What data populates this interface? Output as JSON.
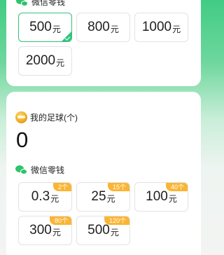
{
  "top_section": {
    "title": "微信零钱",
    "options": [
      {
        "amount": "500",
        "unit": "元",
        "selected": true
      },
      {
        "amount": "800",
        "unit": "元"
      },
      {
        "amount": "1000",
        "unit": "元"
      },
      {
        "amount": "2000",
        "unit": "元"
      }
    ]
  },
  "balls": {
    "label": "我的足球(个)",
    "count": "0"
  },
  "bottom_section": {
    "title": "微信零钱",
    "options": [
      {
        "amount": "0.3",
        "unit": "元",
        "badge": "2个"
      },
      {
        "amount": "25",
        "unit": "元",
        "badge": "15个"
      },
      {
        "amount": "100",
        "unit": "元",
        "badge": "40个"
      },
      {
        "amount": "300",
        "unit": "元",
        "badge": "80个"
      },
      {
        "amount": "500",
        "unit": "元",
        "badge": "120个"
      }
    ]
  }
}
